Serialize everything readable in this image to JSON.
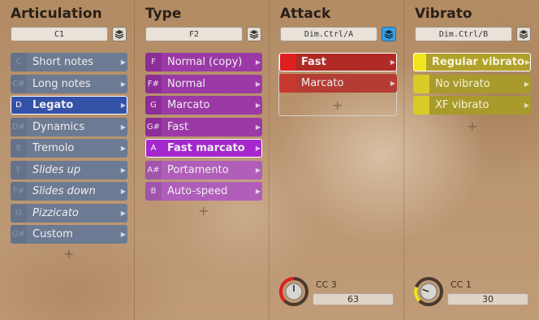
{
  "colors": {
    "articulation_selected": "#3453a8",
    "type_base": "#9b3aa6",
    "type_selected": "#a428cc",
    "attack_red": "#e02020",
    "vibrato_yellow": "#f2e51d",
    "preset_active": "#3aa0e0"
  },
  "articulation": {
    "title": "Articulation",
    "preset": "C1",
    "preset_icon": "layers-icon",
    "items": [
      {
        "key": "C",
        "label": "Short notes",
        "italic": false,
        "selected": false
      },
      {
        "key": "C#",
        "label": "Long notes",
        "italic": false,
        "selected": false
      },
      {
        "key": "D",
        "label": "Legato",
        "italic": false,
        "selected": true
      },
      {
        "key": "D#",
        "label": "Dynamics",
        "italic": false,
        "selected": false
      },
      {
        "key": "E",
        "label": "Tremolo",
        "italic": false,
        "selected": false
      },
      {
        "key": "F",
        "label": "Slides up",
        "italic": true,
        "selected": false
      },
      {
        "key": "F#",
        "label": "Slides down",
        "italic": true,
        "selected": false
      },
      {
        "key": "G",
        "label": "Pizzicato",
        "italic": true,
        "selected": false
      },
      {
        "key": "G#",
        "label": "Custom",
        "italic": false,
        "selected": false
      }
    ],
    "add_label": "+"
  },
  "type": {
    "title": "Type",
    "preset": "F2",
    "preset_icon": "layers-icon",
    "items": [
      {
        "key": "F",
        "label": "Normal (copy)",
        "selected": false
      },
      {
        "key": "F#",
        "label": "Normal",
        "selected": false
      },
      {
        "key": "G",
        "label": "Marcato",
        "selected": false
      },
      {
        "key": "G#",
        "label": "Fast",
        "selected": false
      },
      {
        "key": "A",
        "label": "Fast marcato",
        "selected": true
      },
      {
        "key": "A#",
        "label": "Portamento",
        "selected": false
      },
      {
        "key": "B",
        "label": "Auto-speed",
        "selected": false
      }
    ],
    "add_label": "+"
  },
  "attack": {
    "title": "Attack",
    "preset": "Dim.Ctrl/A",
    "preset_icon": "layers-icon",
    "items": [
      {
        "label": "Fast",
        "selected": true
      },
      {
        "label": "Marcato",
        "selected": false
      }
    ],
    "add_label": "+",
    "cc_label": "CC 3",
    "cc_value": "63",
    "knob_fraction": 0.5
  },
  "vibrato": {
    "title": "Vibrato",
    "preset": "Dim.Ctrl/B",
    "preset_icon": "layers-icon",
    "items": [
      {
        "label": "Regular vibrato",
        "selected": true
      },
      {
        "label": "No vibrato",
        "selected": false
      },
      {
        "label": "XF vibrato",
        "selected": false
      }
    ],
    "add_label": "+",
    "cc_label": "CC 1",
    "cc_value": "30",
    "knob_fraction": 0.24
  }
}
